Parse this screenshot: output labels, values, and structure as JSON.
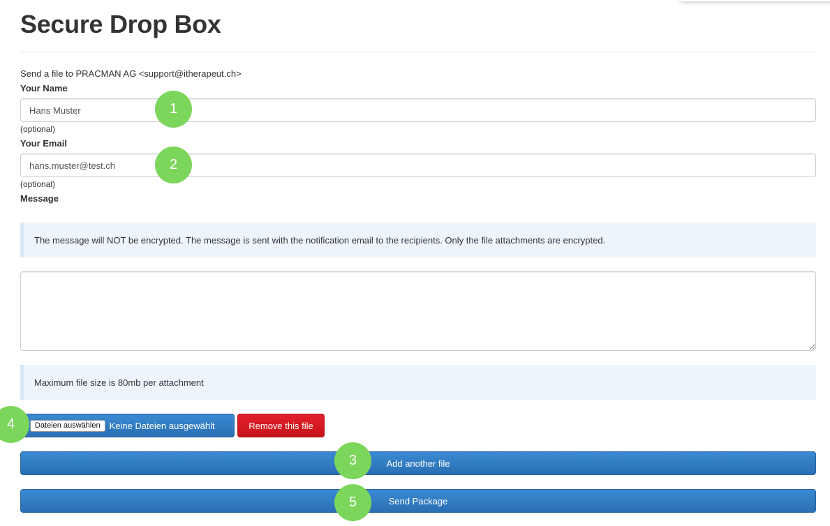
{
  "page": {
    "title": "Secure Drop Box",
    "intro": "Send a file to PRACMAN AG <support@itherapeut.ch>"
  },
  "form": {
    "name_label": "Your Name",
    "name_value": "Hans Muster",
    "name_help": "(optional)",
    "email_label": "Your Email",
    "email_value": "hans.muster@test.ch",
    "email_help": "(optional)",
    "message_label": "Message",
    "message_notice": "The message will NOT be encrypted. The message is sent with the notification email to the recipients. Only the file attachments are encrypted.",
    "message_value": "",
    "file_size_notice": "Maximum file size is 80mb per attachment"
  },
  "file": {
    "choose_label": "Dateien auswählen",
    "status": "Keine Dateien ausgewählt",
    "remove_label": "Remove this file"
  },
  "actions": {
    "add_label": "Add another file",
    "send_label": "Send Package"
  },
  "markers": {
    "m1": "1",
    "m2": "2",
    "m3": "3",
    "m4": "4",
    "m5": "5"
  },
  "colors": {
    "primary": "#2f7dc4",
    "danger": "#d9191f",
    "marker": "#7dd65c",
    "notice_bg": "#edf4fb"
  }
}
